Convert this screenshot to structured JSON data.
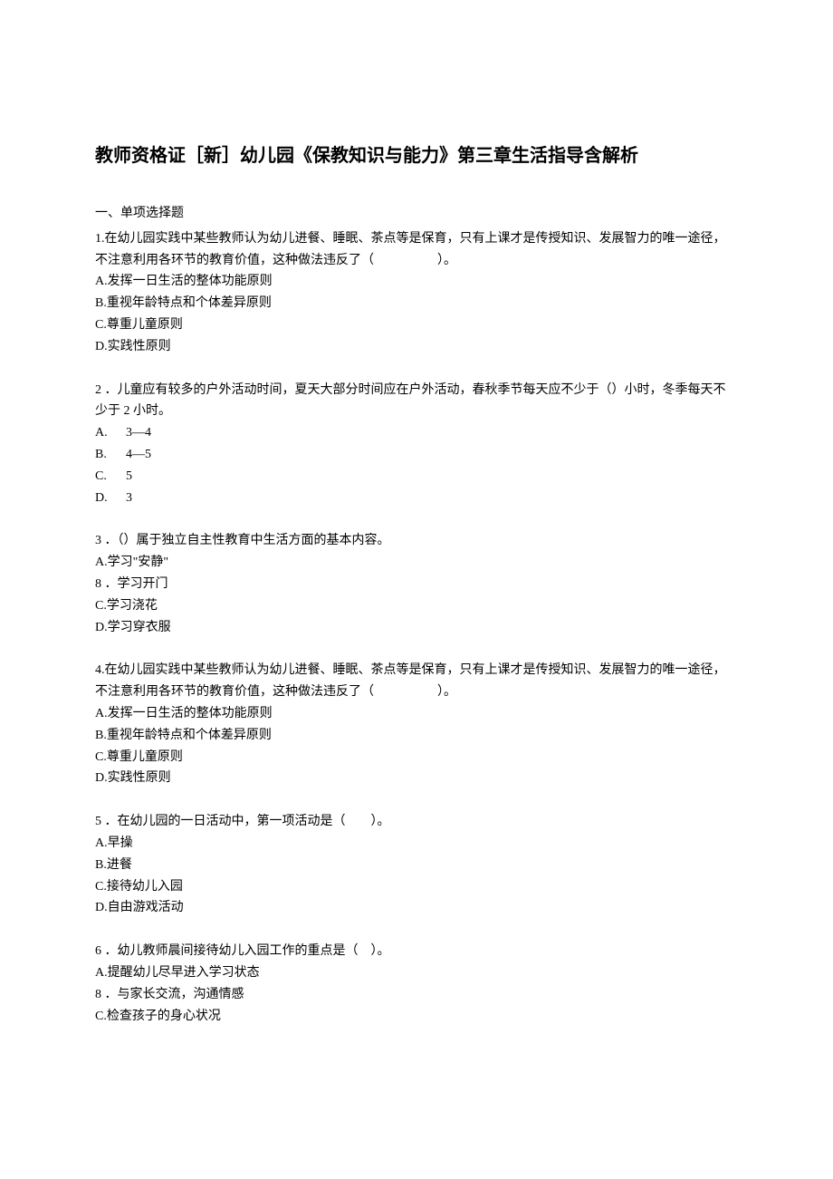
{
  "title": "教师资格证［新］幼儿园《保教知识与能力》第三章生活指导含解析",
  "section_label": "一、单项选择题",
  "questions": [
    {
      "stem": "1.在幼儿园实践中某些教师认为幼儿进餐、睡眠、茶点等是保育，只有上课才是传授知识、发展智力的唯一途径，不注意利用各环节的教育价值，这种做法违反了（　　　　　）。",
      "options": [
        {
          "label": "A.",
          "text": "发挥一日生活的整体功能原则"
        },
        {
          "label": "B.",
          "text": "重视年龄特点和个体差异原则"
        },
        {
          "label": "C.",
          "text": "尊重儿童原则"
        },
        {
          "label": "D.",
          "text": "实践性原则"
        }
      ]
    },
    {
      "stem": "2 ．儿童应有较多的户外活动时间，夏天大部分时间应在户外活动，春秋季节每天应不少于（）小时，冬季每天不少于 2 小时。",
      "wide": true,
      "options": [
        {
          "label": "A.",
          "text": "3—4"
        },
        {
          "label": "B.",
          "text": "4—5"
        },
        {
          "label": "C.",
          "text": "5"
        },
        {
          "label": "D.",
          "text": "3"
        }
      ]
    },
    {
      "stem": "3 ．（）属于独立自主性教育中生活方面的基本内容。",
      "options": [
        {
          "label": "A.",
          "text": "学习\"安静\""
        },
        {
          "label": "8",
          "text": " ．学习开门"
        },
        {
          "label": "C.",
          "text": "学习浇花"
        },
        {
          "label": "D.",
          "text": "学习穿衣服"
        }
      ]
    },
    {
      "stem": "4.在幼儿园实践中某些教师认为幼儿进餐、睡眠、茶点等是保育，只有上课才是传授知识、发展智力的唯一途径，不注意利用各环节的教育价值，这种做法违反了（　　　　　）。",
      "options": [
        {
          "label": "A.",
          "text": "发挥一日生活的整体功能原则"
        },
        {
          "label": "B.",
          "text": "重视年龄特点和个体差异原则"
        },
        {
          "label": "C.",
          "text": "尊重儿童原则"
        },
        {
          "label": "D.",
          "text": "实践性原则"
        }
      ]
    },
    {
      "stem": "5 ．在幼儿园的一日活动中，第一项活动是（　　）。",
      "options": [
        {
          "label": "A.",
          "text": "早操"
        },
        {
          "label": "B.",
          "text": "进餐"
        },
        {
          "label": "C.",
          "text": "接待幼儿入园"
        },
        {
          "label": "D.",
          "text": "自由游戏活动"
        }
      ]
    },
    {
      "stem": "6 ．幼儿教师晨间接待幼儿入园工作的重点是（　）。",
      "no_bottom_margin": true,
      "options": [
        {
          "label": "A.",
          "text": "提醒幼儿尽早进入学习状态"
        },
        {
          "label": "8",
          "text": " ．与家长交流，沟通情感"
        },
        {
          "label": "C.",
          "text": "检查孩子的身心状况"
        }
      ]
    }
  ]
}
